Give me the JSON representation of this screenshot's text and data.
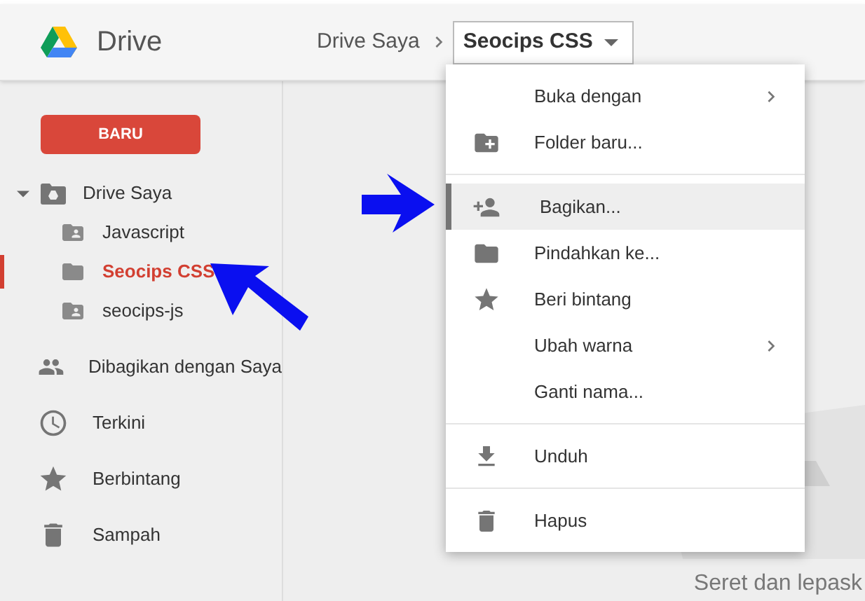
{
  "header": {
    "app_name": "Drive",
    "breadcrumb": [
      {
        "label": "Drive Saya",
        "current": false
      },
      {
        "label": "Seocips CSS",
        "current": true
      }
    ]
  },
  "sidebar": {
    "new_button": "BARU",
    "tree": [
      {
        "label": "Drive Saya",
        "kind": "drive",
        "expanded": true,
        "selected": false,
        "children": [
          {
            "label": "Javascript",
            "kind": "shared",
            "selected": false
          },
          {
            "label": "Seocips CSS",
            "kind": "plain",
            "selected": true
          },
          {
            "label": "seocips-js",
            "kind": "shared",
            "selected": false
          }
        ]
      }
    ],
    "items": [
      {
        "label": "Dibagikan dengan Saya",
        "kind": "people"
      },
      {
        "label": "Terkini",
        "kind": "clock"
      },
      {
        "label": "Berbintang",
        "kind": "star"
      },
      {
        "label": "Sampah",
        "kind": "trash"
      }
    ]
  },
  "main": {
    "drop_hint": "Seret dan lepask"
  },
  "context_menu": {
    "groups": [
      [
        {
          "label": "Buka dengan",
          "kind": "plain",
          "submenu": true,
          "selected": false
        },
        {
          "label": "Folder baru...",
          "kind": "new-folder",
          "submenu": false,
          "selected": false
        }
      ],
      [
        {
          "label": "Bagikan...",
          "kind": "add-person",
          "submenu": false,
          "selected": true
        },
        {
          "label": "Pindahkan ke...",
          "kind": "folder",
          "submenu": false,
          "selected": false
        },
        {
          "label": "Beri bintang",
          "kind": "star",
          "submenu": false,
          "selected": false
        },
        {
          "label": "Ubah warna",
          "kind": "plain",
          "submenu": true,
          "selected": false
        },
        {
          "label": "Ganti nama...",
          "kind": "plain",
          "submenu": false,
          "selected": false
        }
      ],
      [
        {
          "label": "Unduh",
          "kind": "download",
          "submenu": false,
          "selected": false
        }
      ],
      [
        {
          "label": "Hapus",
          "kind": "trash",
          "submenu": false,
          "selected": false
        }
      ]
    ]
  }
}
